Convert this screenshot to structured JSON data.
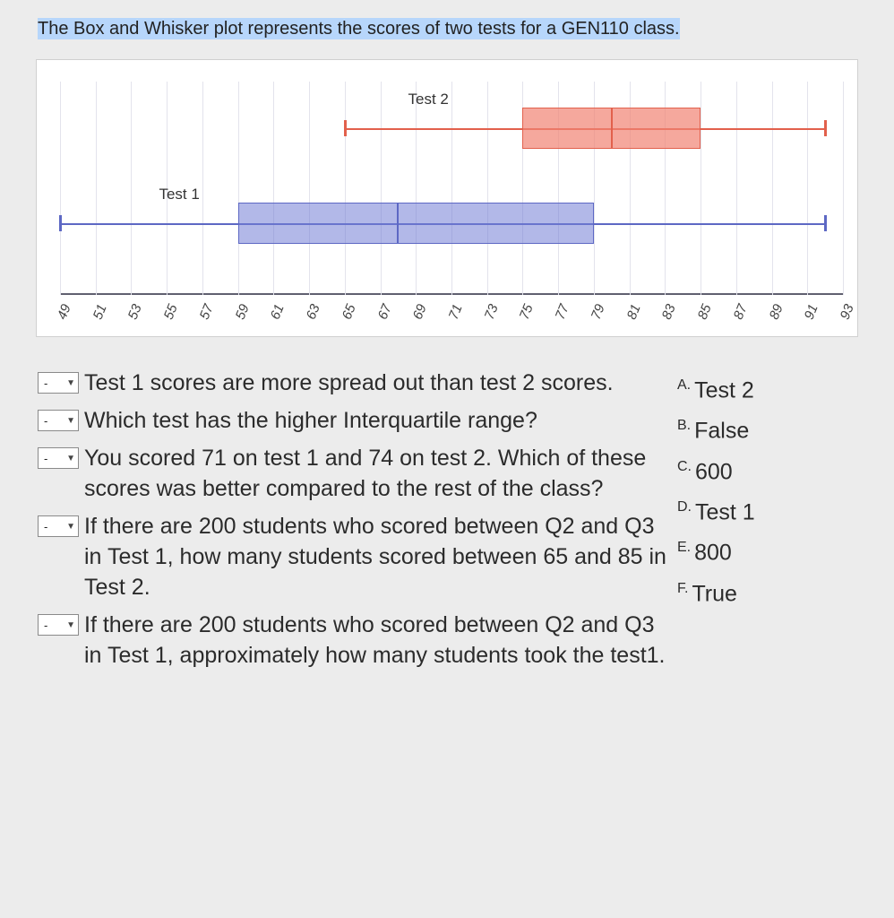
{
  "prompt_text": "The Box and Whisker plot  represents the scores of two tests for a GEN110 class.",
  "chart_data": {
    "type": "boxplot",
    "x_ticks": [
      49,
      51,
      53,
      55,
      57,
      59,
      61,
      63,
      65,
      67,
      69,
      71,
      73,
      75,
      77,
      79,
      81,
      83,
      85,
      87,
      89,
      91,
      93
    ],
    "x_range": [
      49,
      93
    ],
    "series": [
      {
        "name": "Test 1",
        "label": "Test 1",
        "color": "blue",
        "min": 49,
        "q1": 59,
        "median": 68,
        "q3": 79,
        "max": 92
      },
      {
        "name": "Test 2",
        "label": "Test 2",
        "color": "red",
        "min": 65,
        "q1": 75,
        "median": 80,
        "q3": 85,
        "max": 92
      }
    ]
  },
  "dropdown_placeholder": "-",
  "questions": [
    "Test 1 scores are more spread out than test 2 scores.",
    "Which test has the higher Interquartile range?",
    "You scored 71 on test 1 and 74 on test 2. Which of these scores was better compared to the rest of the class?",
    "If there are 200 students who scored between Q2 and Q3 in Test 1, how many students scored between 65 and 85 in Test 2.",
    "If there are 200 students who scored between Q2 and Q3 in Test 1, approximately how many students took the test1."
  ],
  "answers": [
    {
      "letter": "A.",
      "text": "Test 2"
    },
    {
      "letter": "B.",
      "text": "False"
    },
    {
      "letter": "C.",
      "text": "600"
    },
    {
      "letter": "D.",
      "text": "Test 1"
    },
    {
      "letter": "E.",
      "text": "800"
    },
    {
      "letter": "F.",
      "text": "True"
    }
  ]
}
